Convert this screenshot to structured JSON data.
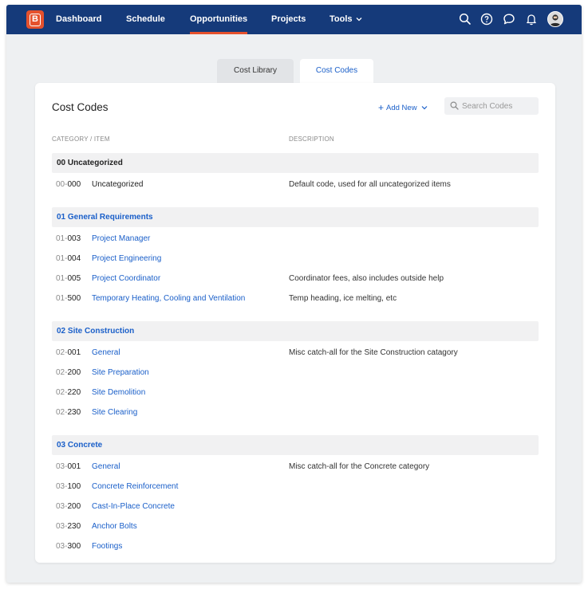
{
  "nav": {
    "logo_letter": "B",
    "items": [
      {
        "label": "Dashboard"
      },
      {
        "label": "Schedule"
      },
      {
        "label": "Opportunities",
        "active": true
      },
      {
        "label": "Projects"
      },
      {
        "label": "Tools"
      }
    ],
    "icons": [
      "search-icon",
      "help-icon",
      "chat-icon",
      "bell-icon",
      "avatar"
    ]
  },
  "tabs": [
    {
      "label": "Cost Library"
    },
    {
      "label": "Cost Codes",
      "active": true
    }
  ],
  "card": {
    "title": "Cost Codes",
    "add_new_label": "Add New",
    "search_placeholder": "Search Codes",
    "col_category": "CATEGORY / ITEM",
    "col_description": "DESCRIPTION"
  },
  "categories": [
    {
      "label": "00 Uncategorized",
      "items": [
        {
          "prefix": "00-",
          "code": "000",
          "name": "Uncategorized",
          "description": "Default code, used for all uncategorized items"
        }
      ]
    },
    {
      "label": "01 General Requirements",
      "items": [
        {
          "prefix": "01-",
          "code": "003",
          "name": "Project Manager",
          "description": ""
        },
        {
          "prefix": "01-",
          "code": "004",
          "name": "Project Engineering",
          "description": ""
        },
        {
          "prefix": "01-",
          "code": "005",
          "name": "Project Coordinator",
          "description": "Coordinator fees, also includes outside help"
        },
        {
          "prefix": "01-",
          "code": "500",
          "name": "Temporary Heating, Cooling and Ventilation",
          "description": "Temp heading, ice melting, etc"
        }
      ]
    },
    {
      "label": "02 Site Construction",
      "items": [
        {
          "prefix": "02-",
          "code": "001",
          "name": "General",
          "description": "Misc catch-all for the Site Construction catagory"
        },
        {
          "prefix": "02-",
          "code": "200",
          "name": "Site Preparation",
          "description": ""
        },
        {
          "prefix": "02-",
          "code": "220",
          "name": "Site Demolition",
          "description": ""
        },
        {
          "prefix": "02-",
          "code": "230",
          "name": "Site Clearing",
          "description": ""
        }
      ]
    },
    {
      "label": "03 Concrete",
      "items": [
        {
          "prefix": "03-",
          "code": "001",
          "name": "General",
          "description": "Misc catch-all for the Concrete category"
        },
        {
          "prefix": "03-",
          "code": "100",
          "name": "Concrete Reinforcement",
          "description": ""
        },
        {
          "prefix": "03-",
          "code": "200",
          "name": "Cast-In-Place Concrete",
          "description": ""
        },
        {
          "prefix": "03-",
          "code": "230",
          "name": "Anchor Bolts",
          "description": ""
        },
        {
          "prefix": "03-",
          "code": "300",
          "name": "Footings",
          "description": ""
        }
      ]
    }
  ],
  "colors": {
    "nav_bg": "#153a7a",
    "accent": "#e5512d",
    "link": "#1a5fc9"
  }
}
